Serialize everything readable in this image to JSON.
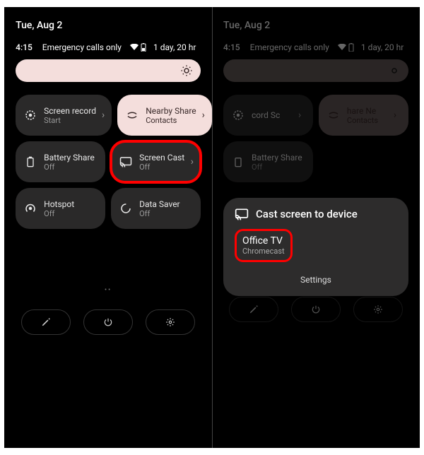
{
  "left": {
    "date": "Tue, Aug 2",
    "time": "4:15",
    "network": "Emergency calls only",
    "battery": "1 day, 20 hr",
    "tiles": [
      {
        "label": "Screen record",
        "sub": "Start"
      },
      {
        "label": "Nearby Share",
        "sub": "Contacts"
      },
      {
        "label": "Battery Share",
        "sub": "Off"
      },
      {
        "label": "Screen Cast",
        "sub": "Off"
      },
      {
        "label": "Hotspot",
        "sub": "Off"
      },
      {
        "label": "Data Saver",
        "sub": "Off"
      }
    ]
  },
  "right": {
    "date": "Tue, Aug 2",
    "time": "4:15",
    "network": "Emergency calls only",
    "battery": "1 day, 20 hr",
    "tiles": [
      {
        "label": "cord   Sc",
        "sub": ""
      },
      {
        "label": "hare   Ne",
        "sub": "Contacts"
      },
      {
        "label": "Battery Share",
        "sub": "Off"
      }
    ],
    "cast": {
      "title": "Cast screen to device",
      "device_name": "Office TV",
      "device_type": "Chromecast",
      "settings": "Settings"
    }
  },
  "colors": {
    "accent_pink": "#f4dedc",
    "tile_bg": "#2a2929",
    "highlight_red": "#ff0000"
  }
}
